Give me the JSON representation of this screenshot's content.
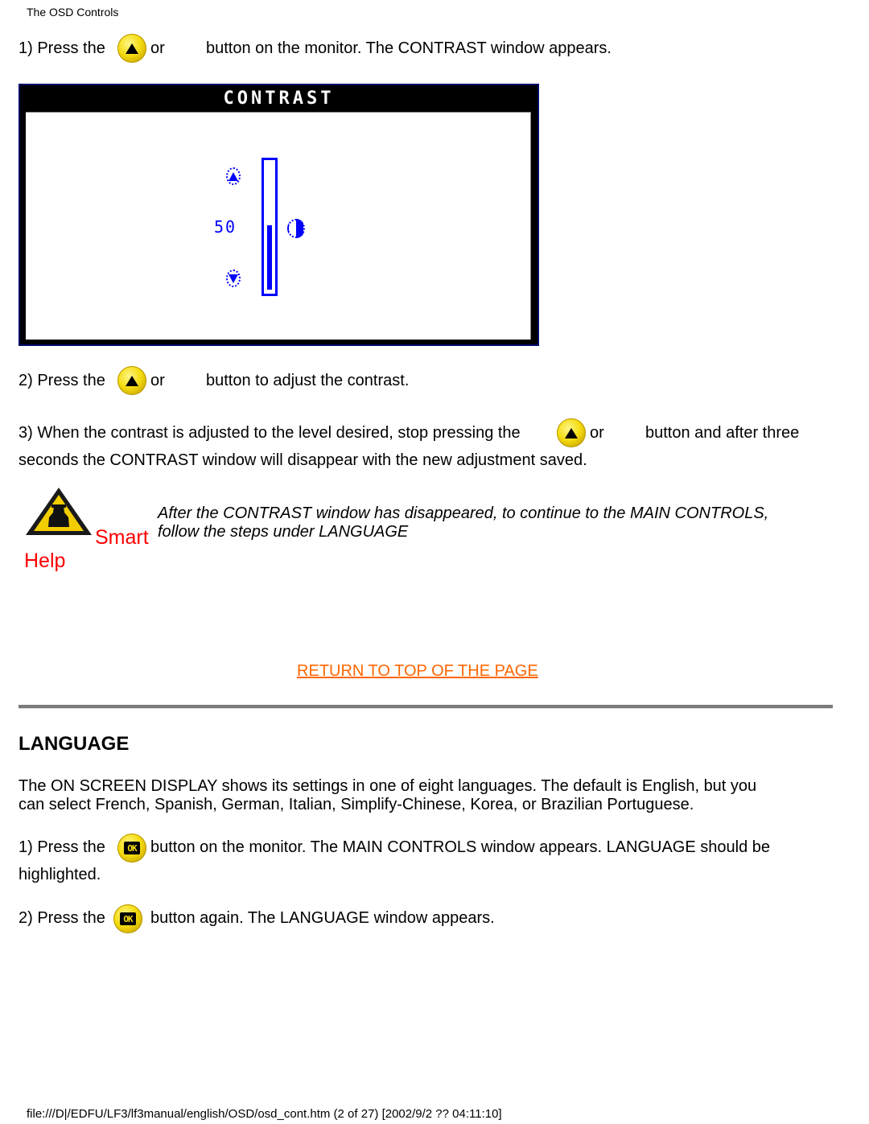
{
  "header": {
    "title": "The OSD Controls"
  },
  "contrast_section": {
    "step1": {
      "prefix": "1) Press the",
      "or": "or",
      "suffix": "button on the monitor. The CONTRAST window appears."
    },
    "osd_window": {
      "title": "CONTRAST",
      "value": "50",
      "level_percent": 50,
      "up_icon": "up-arrow-circle-icon",
      "down_icon": "down-arrow-circle-icon",
      "contrast_icon": "half-circle-contrast-icon",
      "accent_color": "#0000ff"
    },
    "step2": {
      "prefix": "2) Press the",
      "or": "or",
      "suffix": "button to adjust the contrast."
    },
    "step3": {
      "prefix": "3) When the contrast is adjusted to the level desired, stop pressing the",
      "or": "or",
      "suffix": "button and after three",
      "line2": "seconds the CONTRAST window will disappear with the new adjustment saved."
    },
    "smart_help": {
      "label_smart": "Smart",
      "label_help": "Help",
      "line1": "After the CONTRAST window has disappeared, to continue to the MAIN CONTROLS,",
      "line2": "follow the steps under LANGUAGE"
    },
    "return_link": "RETURN TO TOP OF THE PAGE"
  },
  "language_section": {
    "heading": "LANGUAGE",
    "intro_line1": "The ON SCREEN DISPLAY shows its settings in one of eight languages. The default is English, but you",
    "intro_line2": "can select French, Spanish, German, Italian, Simplify-Chinese, Korea, or Brazilian Portuguese.",
    "step1": {
      "prefix": "1) Press the",
      "suffix": "button on the monitor. The MAIN CONTROLS window appears. LANGUAGE should be",
      "line2": "highlighted."
    },
    "step2": {
      "prefix": "2) Press the",
      "suffix": "button again. The LANGUAGE window appears."
    },
    "menu_button_glyph": "OK"
  },
  "footer": {
    "path": "file:///D|/EDFU/LF3/lf3manual/english/OSD/osd_cont.htm (2 of 27) [2002/9/2 ?? 04:11:10]"
  },
  "colors": {
    "link": "#ff6600",
    "smart_help": "#ff0000",
    "osd_border": "#000c6a",
    "button_yellow": "#f5dc10"
  }
}
